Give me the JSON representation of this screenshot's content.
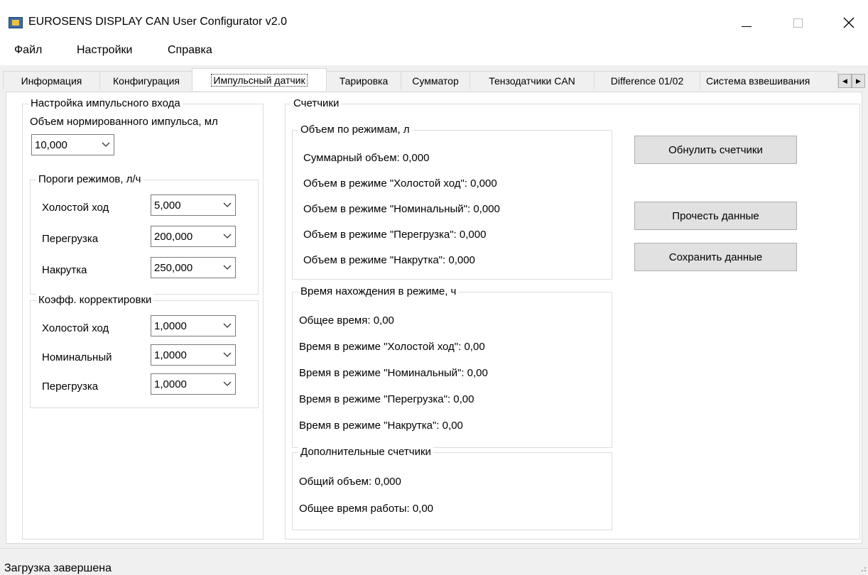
{
  "window": {
    "title": "EUROSENS DISPLAY CAN User Configurator v2.0",
    "icons": {
      "app": "app-icon",
      "minimize": "minimize-icon",
      "maximize": "maximize-icon",
      "close": "close-icon"
    }
  },
  "menu": {
    "items": [
      "Файл",
      "Настройки",
      "Справка"
    ]
  },
  "tabs": [
    {
      "label": "Информация",
      "active": false
    },
    {
      "label": "Конфигурация",
      "active": false
    },
    {
      "label": "Импульсный датчик",
      "active": true
    },
    {
      "label": "Тарировка",
      "active": false
    },
    {
      "label": "Сумматор",
      "active": false
    },
    {
      "label": "Тензодатчики CAN",
      "active": false
    },
    {
      "label": "Difference 01/02",
      "active": false
    },
    {
      "label": "Система взвешивания",
      "active": false
    }
  ],
  "pulse_input": {
    "legend": "Настройка импульсного входа",
    "norm_volume_label": "Объем нормированного импульса, мл",
    "norm_volume_value": "10,000",
    "thresholds": {
      "legend": "Пороги режимов, л/ч",
      "rows": [
        {
          "label": "Холостой ход",
          "value": "5,000"
        },
        {
          "label": "Перегрузка",
          "value": "200,000"
        },
        {
          "label": "Накрутка",
          "value": "250,000"
        }
      ]
    },
    "correction": {
      "legend": "Коэфф. корректировки",
      "rows": [
        {
          "label": "Холостой ход",
          "value": "1,0000"
        },
        {
          "label": "Номинальный",
          "value": "1,0000"
        },
        {
          "label": "Перегрузка",
          "value": "1,0000"
        }
      ]
    }
  },
  "counters": {
    "legend": "Счетчики",
    "volume": {
      "legend": "Объем по режимам, л",
      "lines": [
        "Суммарный объем: 0,000",
        "Объем в режиме \"Холостой ход\": 0,000",
        "Объем в режиме \"Номинальный\": 0,000",
        "Объем в режиме \"Перегрузка\": 0,000",
        "Объем в режиме \"Накрутка\": 0,000"
      ]
    },
    "time": {
      "legend": "Время нахождения в режиме, ч",
      "lines": [
        "Общее время: 0,00",
        "Время в режиме \"Холостой ход\": 0,00",
        "Время в режиме \"Номинальный\": 0,00",
        "Время в режиме \"Перегрузка\": 0,00",
        "Время в режиме \"Накрутка\": 0,00"
      ]
    },
    "extra": {
      "legend": "Дополнительные счетчики",
      "lines": [
        "Общий объем: 0,000",
        "Общее время работы: 0,00"
      ]
    },
    "buttons": {
      "reset": "Обнулить счетчики",
      "read": "Прочесть данные",
      "save": "Сохранить данные"
    }
  },
  "status": {
    "text": "Загрузка завершена"
  }
}
